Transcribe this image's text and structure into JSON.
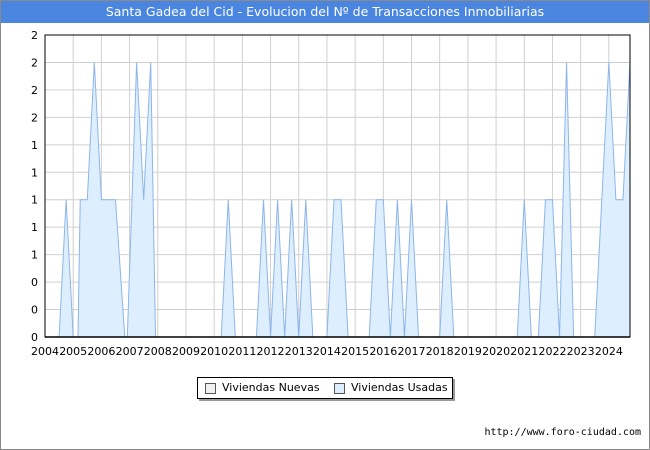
{
  "chart_data": {
    "type": "area",
    "title": "Santa Gadea del Cid - Evolucion del Nº de Transacciones Inmobiliarias",
    "y_tick_labels": [
      "0",
      "0",
      "0",
      "1",
      "1",
      "1",
      "1",
      "1",
      "2",
      "2",
      "2",
      "2"
    ],
    "ylim": [
      0,
      2.2
    ],
    "x_tick_labels": [
      "2004",
      "2005",
      "2006",
      "2007",
      "2008",
      "2009",
      "2010",
      "2011",
      "2012",
      "2013",
      "2014",
      "2015",
      "2016",
      "2017",
      "2018",
      "2019",
      "2020",
      "2021",
      "2022",
      "2023",
      "2024"
    ],
    "xlim": [
      2004,
      2024.75
    ],
    "grid": true,
    "legend_position": "bottom-center",
    "colors": {
      "nuevas_fill": "#f0f0f0",
      "usadas_fill": "#ddeeff",
      "usadas_line": "#8eb5ea",
      "title_bar": "#4a86e0",
      "grid": "#d0d0d0"
    },
    "series": [
      {
        "name": "Viviendas Nuevas",
        "points": []
      },
      {
        "name": "Viviendas Usadas",
        "points": [
          [
            2004.5,
            0
          ],
          [
            2004.75,
            1
          ],
          [
            2005.0,
            0
          ],
          [
            2005.17,
            0
          ],
          [
            2005.25,
            1
          ],
          [
            2005.5,
            1
          ],
          [
            2005.75,
            2
          ],
          [
            2006.0,
            1
          ],
          [
            2006.25,
            1
          ],
          [
            2006.5,
            1
          ],
          [
            2006.83,
            0
          ],
          [
            2006.92,
            0
          ],
          [
            2007.25,
            2
          ],
          [
            2007.5,
            1
          ],
          [
            2007.75,
            2
          ],
          [
            2007.92,
            0
          ],
          [
            2010.25,
            0
          ],
          [
            2010.5,
            1
          ],
          [
            2010.75,
            0
          ],
          [
            2011.5,
            0
          ],
          [
            2011.75,
            1
          ],
          [
            2012.0,
            0
          ],
          [
            2012.25,
            1
          ],
          [
            2012.5,
            0
          ],
          [
            2012.75,
            1
          ],
          [
            2013.0,
            0
          ],
          [
            2013.25,
            1
          ],
          [
            2013.5,
            0
          ],
          [
            2014.0,
            0
          ],
          [
            2014.25,
            1
          ],
          [
            2014.5,
            1
          ],
          [
            2014.75,
            0
          ],
          [
            2015.5,
            0
          ],
          [
            2015.75,
            1
          ],
          [
            2016.0,
            1
          ],
          [
            2016.25,
            0
          ],
          [
            2016.5,
            1
          ],
          [
            2016.75,
            0
          ],
          [
            2017.0,
            1
          ],
          [
            2017.25,
            0
          ],
          [
            2018.0,
            0
          ],
          [
            2018.25,
            1
          ],
          [
            2018.5,
            0
          ],
          [
            2020.75,
            0
          ],
          [
            2021.0,
            1
          ],
          [
            2021.25,
            0
          ],
          [
            2021.5,
            0
          ],
          [
            2021.75,
            1
          ],
          [
            2022.0,
            1
          ],
          [
            2022.25,
            0
          ],
          [
            2022.5,
            2
          ],
          [
            2022.75,
            0
          ],
          [
            2023.5,
            0
          ],
          [
            2023.75,
            1
          ],
          [
            2024.0,
            2
          ],
          [
            2024.25,
            1
          ],
          [
            2024.5,
            1
          ],
          [
            2024.75,
            2
          ],
          [
            2024.75,
            0
          ]
        ]
      }
    ]
  },
  "legend": {
    "items": [
      {
        "label": "Viviendas Nuevas",
        "color": "#f0f0f0"
      },
      {
        "label": "Viviendas Usadas",
        "color": "#ddeeff"
      }
    ]
  },
  "source": "http://www.foro-ciudad.com"
}
